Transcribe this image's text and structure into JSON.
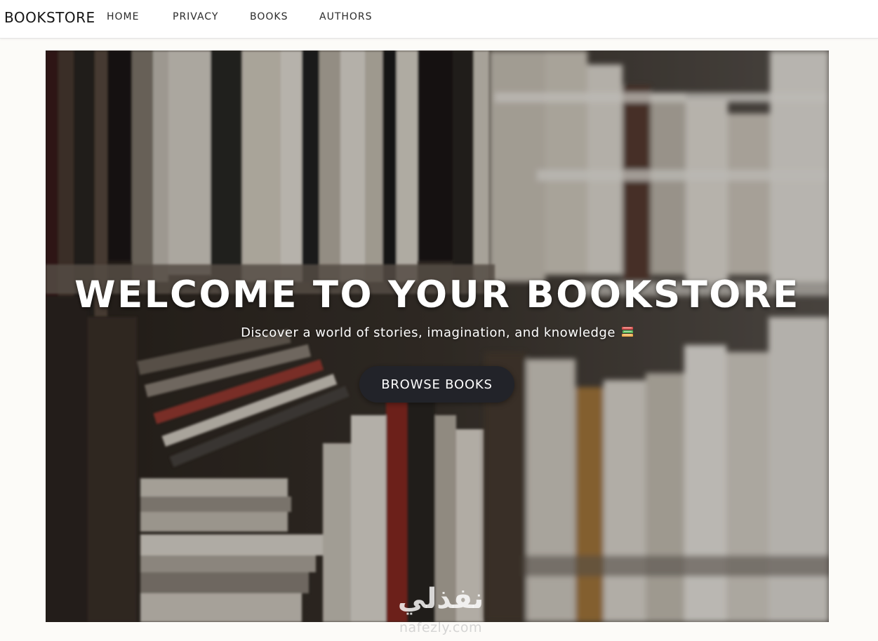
{
  "navbar": {
    "brand": "BOOKSTORE",
    "links": [
      "HOME",
      "PRIVACY",
      "BOOKS",
      "AUTHORS"
    ]
  },
  "hero": {
    "title": "WELCOME TO YOUR BOOKSTORE",
    "subtitle": "Discover a world of stories, imagination, and knowledge",
    "subtitle_icon": "books-emoji-icon",
    "button_label": "BROWSE BOOKS",
    "background": "photo of bookshelves filled with books"
  },
  "watermark": {
    "arabic": "نفذلي",
    "latin": "nafezly.com"
  },
  "colors": {
    "page_bg": "#fcfbf8",
    "navbar_bg": "#ffffff",
    "button_bg": "#222329",
    "text_light": "#ffffff"
  }
}
